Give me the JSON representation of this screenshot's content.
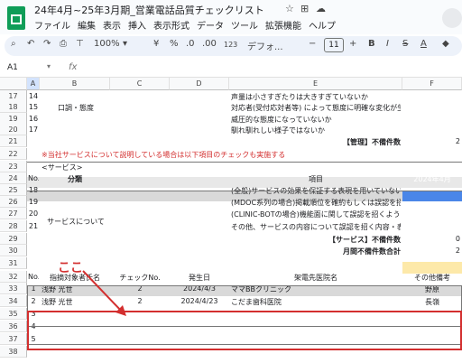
{
  "doc_title": "24年4月~25年3月期_営業電話品質チェックリスト",
  "title_icons": [
    "☆",
    "⊞",
    "☁"
  ],
  "menu": [
    "ファイル",
    "編集",
    "表示",
    "挿入",
    "表示形式",
    "データ",
    "ツール",
    "拡張機能",
    "ヘルプ"
  ],
  "toolbar": {
    "zoom": "100%",
    "currency": "¥",
    "percent": "%",
    "dec_down": ".0",
    "dec_up": ".00",
    "number_format": "123",
    "font": "デフォ...",
    "font_size": "11"
  },
  "name_box": "A1",
  "fx": "fx",
  "columns": [
    "A",
    "B",
    "C",
    "D",
    "E",
    "F"
  ],
  "rows": [
    {
      "n": "17",
      "a": "14",
      "e": "声量は小さすぎたりは大きすぎていないか"
    },
    {
      "n": "18",
      "a": "15",
      "e": "対応者(受付応対者等) によって態度に明確な変化が生じていないか"
    },
    {
      "n": "19",
      "a": "16",
      "e": "威圧的な態度になっていないか"
    },
    {
      "n": "20",
      "a": "17",
      "e": "馴れ馴れしい様子ではないか"
    },
    {
      "n": "21",
      "e": "【管理】不備件数",
      "f": "2"
    },
    {
      "n": "22",
      "b": "※当社サービスについて説明している場合は以下項目のチェックも実施する"
    },
    {
      "n": "23",
      "b": "<サービス>"
    },
    {
      "n": "24",
      "a": "No.",
      "b": "分類",
      "e": "項目",
      "f": "2024年4月"
    },
    {
      "n": "25",
      "a": "18",
      "e": "(全般)サービスの効果を保証する表現を用いていないか"
    },
    {
      "n": "26",
      "a": "19",
      "e": "(MDOC系列の場合)掲載順位を確約もしくは誤認を招くような表現を用いていないか"
    },
    {
      "n": "27",
      "a": "20",
      "e": "(CLINIC-BOTの場合)機能面に関して誤認を招くような過大な表現を用いていないか"
    },
    {
      "n": "28",
      "a": "21",
      "e": "その他、サービスの内容について誤認を招く内容・表現を用いていないか"
    },
    {
      "n": "29",
      "e": "【サービス】不備件数",
      "f": "0"
    },
    {
      "n": "30",
      "e": "月間不備件数合計",
      "f": "2"
    },
    {
      "n": "31"
    },
    {
      "n": "32",
      "a": "No.",
      "b": "指摘対象者氏名",
      "c": "チェックNo.",
      "d": "発生日",
      "e": "架電先医院名",
      "f": "その他備考"
    },
    {
      "n": "33",
      "a": "1",
      "b": "浅野 光世",
      "c": "2",
      "d": "2024/4/3",
      "e": "ママBBクリニック",
      "f": "野原"
    },
    {
      "n": "34",
      "a": "2",
      "b": "浅野 光世",
      "c": "2",
      "d": "2024/4/23",
      "e": "こだま歯科医院",
      "f": "長嶺"
    },
    {
      "n": "35",
      "a": "3"
    },
    {
      "n": "36",
      "a": "4"
    },
    {
      "n": "37",
      "a": "5"
    },
    {
      "n": "38"
    }
  ],
  "category_1": "口調・態度",
  "category_2": "サービスについて",
  "annotation": "ここ",
  "colors": {
    "red": "#d32f2f",
    "yellow": "#fde9a9",
    "blue": "#4a86e8",
    "gray": "#d9d9d9",
    "header_bg": "#f8f9fa"
  }
}
